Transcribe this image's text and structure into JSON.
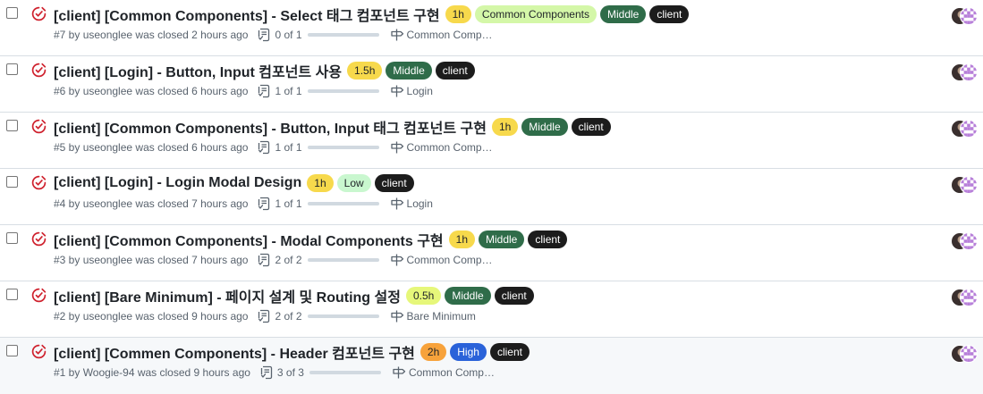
{
  "colors": {
    "closed_icon": "#cf222e",
    "label_time_yellow": "#f7d94c",
    "label_time_orange": "#f7a23b",
    "label_common_components": "#d4f7a8",
    "label_middle": "#2f6c49",
    "label_low": "#c9f7cf",
    "label_high": "#2a62d9",
    "label_client": "#1c1c1c"
  },
  "issues": [
    {
      "title": "[client] [Common Components] - Select 태그 컴포넌트 구현",
      "labels": [
        {
          "text": "1h",
          "bg": "#f7d94c",
          "fg": "#1f2328"
        },
        {
          "text": "Common Components",
          "bg": "#d4f7a8",
          "fg": "#1f2328"
        },
        {
          "text": "Middle",
          "bg": "#2f6c49",
          "fg": "#ffffff"
        },
        {
          "text": "client",
          "bg": "#1c1c1c",
          "fg": "#ffffff"
        }
      ],
      "meta": "#7 by useonglee was closed 2 hours ago",
      "tasks": "0 of 1",
      "progress": 0,
      "milestone": "Common Comp…"
    },
    {
      "title": "[client] [Login] - Button, Input 컴포넌트 사용",
      "labels": [
        {
          "text": "1.5h",
          "bg": "#f7d94c",
          "fg": "#1f2328"
        },
        {
          "text": "Middle",
          "bg": "#2f6c49",
          "fg": "#ffffff"
        },
        {
          "text": "client",
          "bg": "#1c1c1c",
          "fg": "#ffffff"
        }
      ],
      "meta": "#6 by useonglee was closed 6 hours ago",
      "tasks": "1 of 1",
      "progress": 1,
      "milestone": "Login"
    },
    {
      "title": "[client] [Common Components] - Button, Input 태그 컴포넌트 구현",
      "labels": [
        {
          "text": "1h",
          "bg": "#f7d94c",
          "fg": "#1f2328"
        },
        {
          "text": "Middle",
          "bg": "#2f6c49",
          "fg": "#ffffff"
        },
        {
          "text": "client",
          "bg": "#1c1c1c",
          "fg": "#ffffff"
        }
      ],
      "meta": "#5 by useonglee was closed 6 hours ago",
      "tasks": "1 of 1",
      "progress": 1,
      "milestone": "Common Comp…"
    },
    {
      "title": "[client] [Login] - Login Modal Design",
      "labels": [
        {
          "text": "1h",
          "bg": "#f7d94c",
          "fg": "#1f2328"
        },
        {
          "text": "Low",
          "bg": "#c9f7cf",
          "fg": "#1f2328"
        },
        {
          "text": "client",
          "bg": "#1c1c1c",
          "fg": "#ffffff"
        }
      ],
      "meta": "#4 by useonglee was closed 7 hours ago",
      "tasks": "1 of 1",
      "progress": 1,
      "milestone": "Login"
    },
    {
      "title": "[client] [Common Components] - Modal Components 구현",
      "labels": [
        {
          "text": "1h",
          "bg": "#f7d94c",
          "fg": "#1f2328"
        },
        {
          "text": "Middle",
          "bg": "#2f6c49",
          "fg": "#ffffff"
        },
        {
          "text": "client",
          "bg": "#1c1c1c",
          "fg": "#ffffff"
        }
      ],
      "meta": "#3 by useonglee was closed 7 hours ago",
      "tasks": "2 of 2",
      "progress": 1,
      "milestone": "Common Comp…"
    },
    {
      "title": "[client] [Bare Minimum] - 페이지 설계 및 Routing 설정",
      "labels": [
        {
          "text": "0.5h",
          "bg": "#e6f77a",
          "fg": "#1f2328"
        },
        {
          "text": "Middle",
          "bg": "#2f6c49",
          "fg": "#ffffff"
        },
        {
          "text": "client",
          "bg": "#1c1c1c",
          "fg": "#ffffff"
        }
      ],
      "meta": "#2 by useonglee was closed 9 hours ago",
      "tasks": "2 of 2",
      "progress": 1,
      "milestone": "Bare Minimum"
    },
    {
      "title": "[client] [Commen Components] - Header 컴포넌트 구현",
      "labels": [
        {
          "text": "2h",
          "bg": "#f7a23b",
          "fg": "#1f2328"
        },
        {
          "text": "High",
          "bg": "#2a62d9",
          "fg": "#ffffff"
        },
        {
          "text": "client",
          "bg": "#1c1c1c",
          "fg": "#ffffff"
        }
      ],
      "meta": "#1 by Woogie-94 was closed 9 hours ago",
      "tasks": "3 of 3",
      "progress": 1,
      "milestone": "Common Comp…"
    }
  ]
}
